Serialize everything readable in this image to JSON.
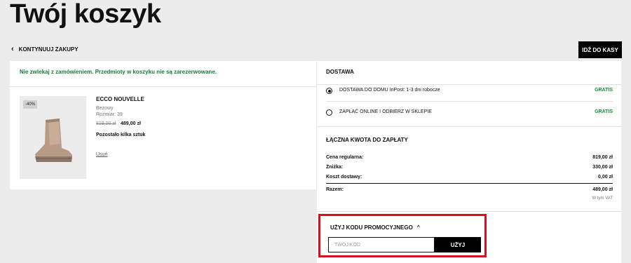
{
  "page": {
    "title": "Twój koszyk"
  },
  "nav": {
    "back_label": "KONTYNUUJ ZAKUPY",
    "checkout_label": "IDŹ DO KASY"
  },
  "cart": {
    "notice": "Nie zwlekaj z zamówieniem. Przedmioty w koszyku nie są zarezerwowane.",
    "item": {
      "badge": "-40%",
      "name": "ECCO NOUVELLE",
      "color": "Beżowy",
      "size": "Rozmiar: 39",
      "price_old": "819,00 zł",
      "price_new": "489,00 zł",
      "stock": "Pozostało kilka sztuk",
      "remove_label": "Usuń"
    }
  },
  "delivery": {
    "title": "DOSTAWA",
    "options": [
      {
        "label": "DOSTAWA DO DOMU InPost: 1-3 dni robocze",
        "price": "GRATIS",
        "selected": true
      },
      {
        "label": "ZAPŁAĆ ONLINE I ODBIERZ W SKLEPIE",
        "price": "GRATIS",
        "selected": false
      }
    ]
  },
  "totals": {
    "title": "ŁĄCZNA KWOTA DO ZAPŁATY",
    "regular_label": "Cena regularna:",
    "regular_value": "819,00 zł",
    "discount_label": "Zniżka:",
    "discount_value": "330,00 zł",
    "shipping_label": "Koszt dostawy:",
    "shipping_value": "0,00 zł",
    "total_label": "Razem:",
    "total_value": "489,00 zł",
    "vat_note": "W tym VAT"
  },
  "promo": {
    "title": "UŻYJ KODU PROMOCYJNEGO",
    "placeholder": "TWÓJ KOD",
    "apply_label": "UŻYJ"
  },
  "colors": {
    "accent_green": "#1b8a3a",
    "highlight_red": "#d4121d",
    "button_black": "#000000"
  }
}
